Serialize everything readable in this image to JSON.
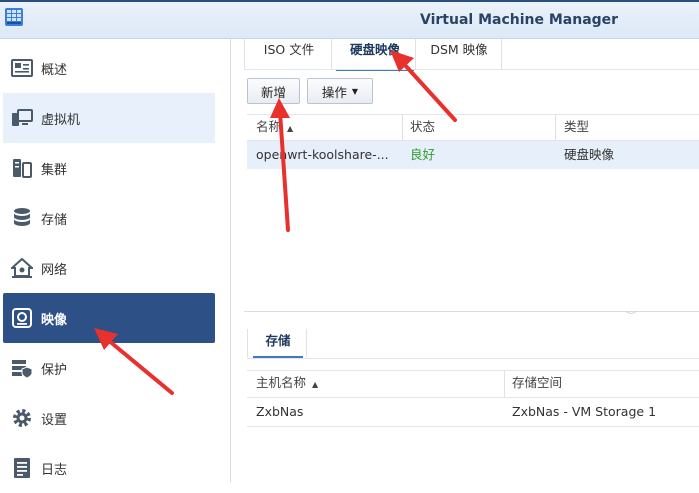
{
  "app": {
    "title": "Virtual Machine Manager"
  },
  "sidebar": {
    "items": [
      {
        "label": "概述",
        "icon": "overview-icon"
      },
      {
        "label": "虚拟机",
        "icon": "vm-icon"
      },
      {
        "label": "集群",
        "icon": "cluster-icon"
      },
      {
        "label": "存储",
        "icon": "storage-icon"
      },
      {
        "label": "网络",
        "icon": "network-icon"
      },
      {
        "label": "映像",
        "icon": "image-icon"
      },
      {
        "label": "保护",
        "icon": "protection-icon"
      },
      {
        "label": "设置",
        "icon": "gear-icon"
      },
      {
        "label": "日志",
        "icon": "log-icon"
      }
    ],
    "active_index": 5,
    "hover_index": 1
  },
  "tabs": [
    {
      "label": "ISO 文件"
    },
    {
      "label": "硬盘映像"
    },
    {
      "label": "DSM 映像"
    }
  ],
  "toolbar": {
    "add_label": "新增",
    "action_label": "操作"
  },
  "image_table": {
    "columns": [
      "名称",
      "状态",
      "类型"
    ],
    "rows": [
      {
        "name": "openwrt-koolshare-...",
        "status": "良好",
        "type": "硬盘映像"
      }
    ]
  },
  "storage_panel": {
    "tab_label": "存储",
    "columns": [
      "主机名称",
      "存储空间"
    ],
    "rows": [
      {
        "host": "ZxbNas",
        "storage": "ZxbNas - VM Storage 1"
      }
    ]
  },
  "colors": {
    "accent": "#2d5087",
    "status_good": "#2e9c2e",
    "arrow": "#e8302d",
    "selected_row": "#e6effa"
  }
}
